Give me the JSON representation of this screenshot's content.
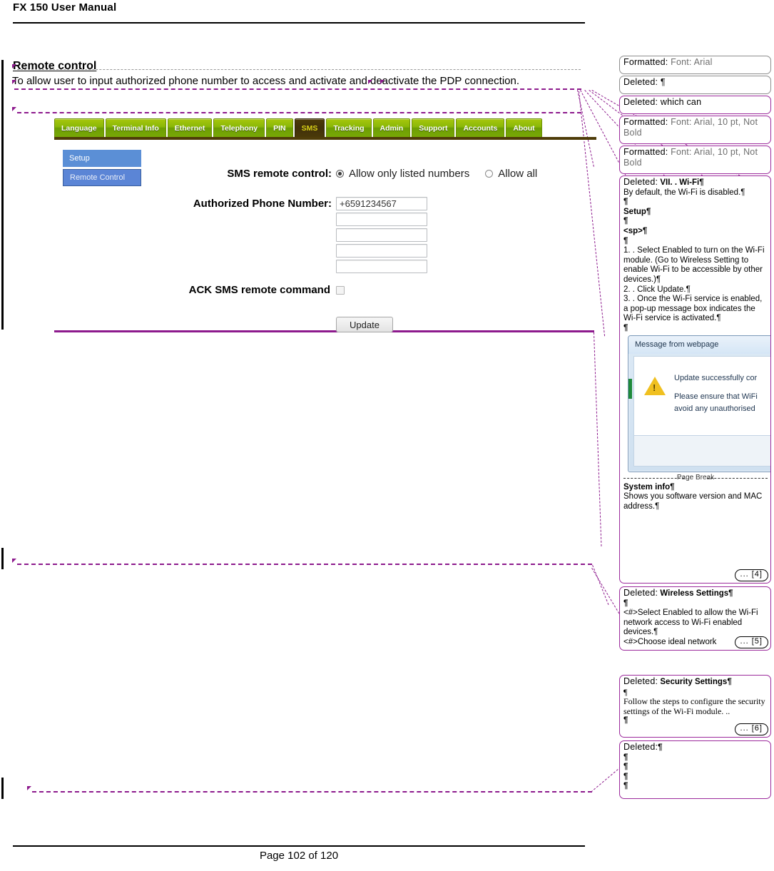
{
  "header": {
    "title": "FX 150 User Manual"
  },
  "footer": {
    "page_label": "Page 102 of 120"
  },
  "section": {
    "heading": "Remote control",
    "body": "To allow user to input authorized phone number to access and activate and deactivate the PDP connection."
  },
  "web_ui": {
    "tabs": [
      {
        "label": "Language",
        "active": false
      },
      {
        "label": "Terminal Info",
        "active": false
      },
      {
        "label": "Ethernet",
        "active": false
      },
      {
        "label": "Telephony",
        "active": false
      },
      {
        "label": "PIN",
        "active": false
      },
      {
        "label": "SMS",
        "active": true
      },
      {
        "label": "Tracking",
        "active": false
      },
      {
        "label": "Admin",
        "active": false
      },
      {
        "label": "Support",
        "active": false
      },
      {
        "label": "Accounts",
        "active": false
      },
      {
        "label": "About",
        "active": false
      }
    ],
    "sidebar": [
      {
        "label": "Setup",
        "selected": false
      },
      {
        "label": "Remote Control",
        "selected": true
      }
    ],
    "form": {
      "remote_control_label": "SMS remote control:",
      "radio_allow_listed": "Allow only listed numbers",
      "radio_allow_all": "Allow all",
      "selected_radio": "Allow only listed numbers",
      "phone_label": "Authorized Phone Number:",
      "phone_values": [
        "+6591234567",
        "",
        "",
        "",
        ""
      ],
      "ack_label": "ACK SMS remote command",
      "ack_checked": false,
      "update_label": "Update"
    },
    "colors": {
      "tab_green": "#8ab808",
      "tab_active_brown": "#40300a",
      "tab_active_text": "#d8d016",
      "sidebar_blue": "#5b8fd6"
    }
  },
  "markup": {
    "revision_color": "#8d1a8d",
    "balloons": [
      {
        "kind": "Formatted:",
        "style": "grey",
        "text": " Font: Arial",
        "continuation": ""
      },
      {
        "kind": "Deleted:",
        "style": "grey",
        "text": " ¶",
        "continuation": ""
      },
      {
        "kind": "Deleted:",
        "style": "purple",
        "text": " which can",
        "continuation": ""
      },
      {
        "kind": "Formatted:",
        "style": "purple",
        "text": " Font: Arial, 10 pt, Not Bold",
        "continuation": ""
      },
      {
        "kind": "Formatted:",
        "style": "purple",
        "text": " Font: Arial, 10 pt, Not Bold",
        "continuation": ""
      },
      {
        "kind": "Deleted:",
        "style": "purple",
        "title": "VII. . Wi-Fi¶",
        "lines": [
          "By default, the Wi-Fi is disabled.¶",
          "¶",
          "Setup¶",
          "¶",
          "<sp>¶",
          "¶",
          "1. . Select Enabled to turn on the Wi-Fi module. (Go to Wireless Setting to enable Wi-Fi to be accessible by other devices.)¶",
          "2. . Click Update.¶",
          "3. . Once the Wi-Fi service is enabled, a pop-up message box indicates the Wi-Fi service is activated.¶",
          "¶"
        ],
        "dialog": {
          "title": "Message from webpage",
          "line1": "Update successfully cor",
          "line2": "Please ensure that WiFi",
          "line3": "avoid any unauthorised",
          "icon": "warning-icon"
        },
        "page_break_label": "Page Break",
        "tail_title": "System info¶",
        "tail_lines": [
          "Shows you software version and MAC address.¶"
        ],
        "continuation": "... [4]"
      },
      {
        "kind": "Deleted:",
        "style": "purple",
        "title": "Wireless Settings¶",
        "lines": [
          "¶",
          "<#>Select Enabled to allow the Wi-Fi network access to Wi-Fi enabled devices.¶",
          "<#>Choose ideal network"
        ],
        "continuation": "... [5]"
      },
      {
        "kind": "Deleted:",
        "style": "purple",
        "title": "Security Settings¶",
        "lines": [
          "¶",
          "Follow the steps to configure the security settings of the Wi-Fi module. ..",
          "¶"
        ],
        "continuation": "... [6]"
      },
      {
        "kind": "Deleted:",
        "style": "purple",
        "title": "¶",
        "lines": [
          "¶",
          "¶",
          "¶",
          "¶"
        ],
        "continuation": ""
      }
    ]
  }
}
